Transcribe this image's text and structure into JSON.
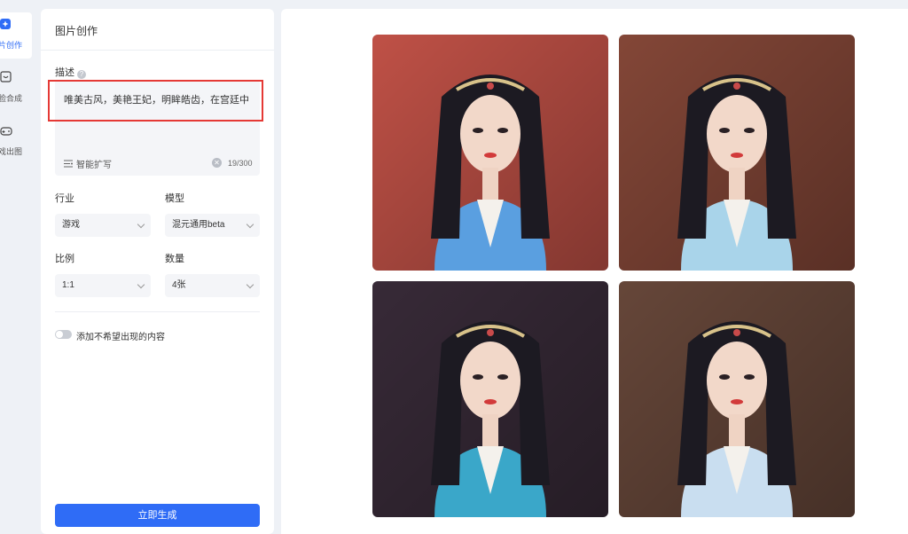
{
  "sidebar": {
    "items": [
      {
        "label": "片创作",
        "icon": "sparkle-icon",
        "active": true
      },
      {
        "label": "脸合成",
        "icon": "face-icon",
        "active": false
      },
      {
        "label": "戏出图",
        "icon": "gamepad-icon",
        "active": false
      }
    ]
  },
  "panel": {
    "title": "图片创作",
    "description": {
      "label": "描述",
      "help_icon": "question-icon",
      "value": "唯美古风，美艳王妃，明眸皓齿，在宫廷中",
      "expand_label": "智能扩写",
      "char_count": "19/300"
    },
    "industry": {
      "label": "行业",
      "value": "游戏"
    },
    "model": {
      "label": "模型",
      "value": "混元通用beta"
    },
    "ratio": {
      "label": "比例",
      "value": "1:1"
    },
    "quantity": {
      "label": "数量",
      "value": "4张"
    },
    "negative_toggle": {
      "label": "添加不希望出现的内容",
      "enabled": false
    },
    "generate_label": "立即生成"
  },
  "results": {
    "images": [
      {
        "alt": "",
        "tone": "#c9554a",
        "robe": "#5a9fe0"
      },
      {
        "alt": "",
        "tone": "#8a4a3a",
        "robe": "#a9d4ea"
      },
      {
        "alt": "",
        "tone": "#3a2c3a",
        "robe": "#3aa7c9"
      },
      {
        "alt": "",
        "tone": "#6b4a3c",
        "robe": "#c9def0"
      }
    ]
  },
  "colors": {
    "accent": "#2f6cf6",
    "highlight": "#e53935"
  }
}
